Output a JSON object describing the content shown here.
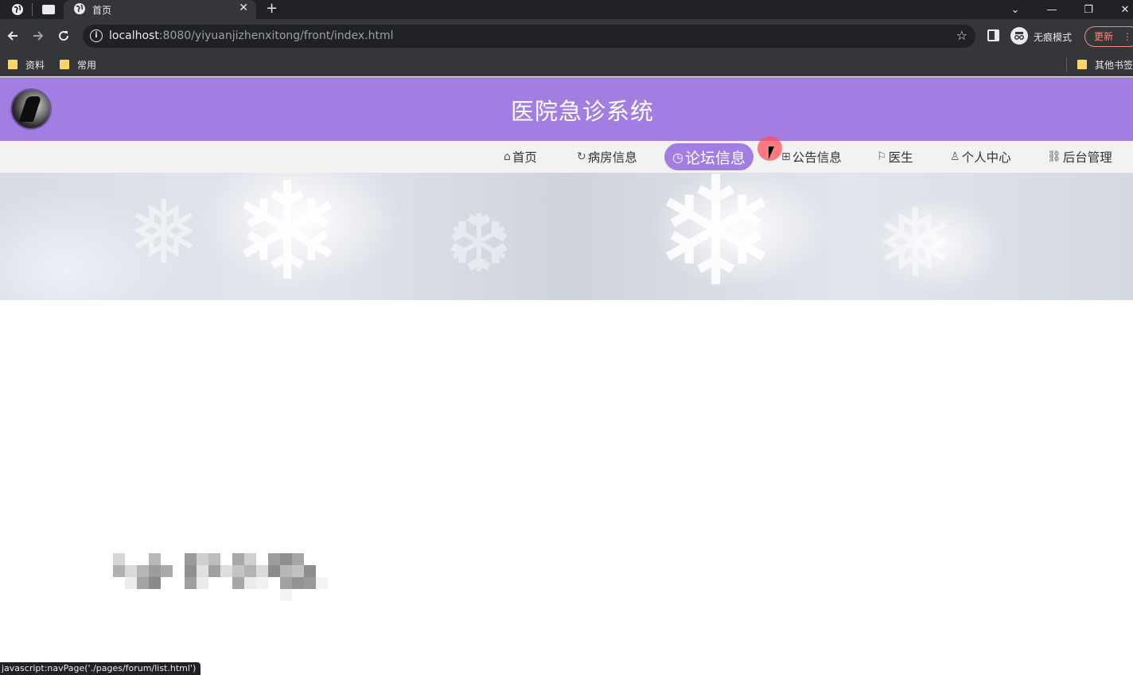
{
  "browser": {
    "tab_title": "首页",
    "url_host": "localhost",
    "url_rest": ":8080/yiyuanjizhenxitong/front/index.html",
    "incognito_label": "无痕模式",
    "update_label": "更新",
    "bookmarks": [
      "资料",
      "常用"
    ],
    "other_bookmarks": "其他书签",
    "status_text": "javascript:navPage('./pages/forum/list.html')"
  },
  "header": {
    "title": "医院急诊系统"
  },
  "nav": {
    "items": [
      {
        "label": "首页",
        "icon": "home-icon"
      },
      {
        "label": "病房信息",
        "icon": "refresh-icon"
      },
      {
        "label": "论坛信息",
        "icon": "clock-icon",
        "active": true
      },
      {
        "label": "公告信息",
        "icon": "apps-icon"
      },
      {
        "label": "医生",
        "icon": "flag-icon"
      },
      {
        "label": "个人中心",
        "icon": "user-icon"
      },
      {
        "label": "后台管理",
        "icon": "link-icon"
      }
    ]
  },
  "colors": {
    "accent": "#a27ee3",
    "navbar_bg": "#f2f2f2"
  }
}
